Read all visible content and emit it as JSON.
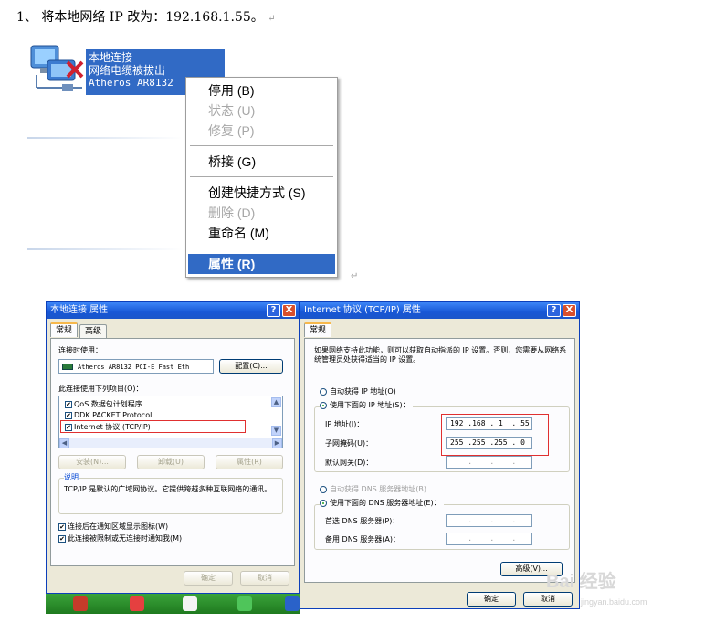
{
  "heading": {
    "text": "1、 将本地网络 IP 改为：192.168.1.55。",
    "para_mark": "↵"
  },
  "connection": {
    "line1": "本地连接",
    "line2": "网络电缆被拔出",
    "line3": "Atheros AR8132"
  },
  "context_menu": {
    "items": [
      {
        "label": "停用 (B)"
      },
      {
        "label": "状态 (U)"
      },
      {
        "label": "修复 (P)"
      },
      {
        "label": "桥接 (G)"
      },
      {
        "label": "创建快捷方式 (S)"
      },
      {
        "label": "删除 (D)"
      },
      {
        "label": "重命名 (M)"
      },
      {
        "label": "属性 (R)"
      }
    ]
  },
  "para_mark2": "↵",
  "dialog_left": {
    "title": "本地连接 属性",
    "help": "?",
    "close": "X",
    "tabs": [
      "常规",
      "高级"
    ],
    "connect_using_label": "连接时使用：",
    "adapter_name": "Atheros AR8132 PCI-E Fast Eth",
    "configure_button": "配置(C)...",
    "items_label": "此连接使用下列项目(O)：",
    "components": [
      {
        "label": "QoS 数据包计划程序",
        "checked": true
      },
      {
        "label": "DDK PACKET Protocol",
        "checked": true
      },
      {
        "label": "Internet 协议 (TCP/IP)",
        "checked": true
      }
    ],
    "install_button": "安装(N)...",
    "uninstall_button": "卸载(U)",
    "properties_button": "属性(R)",
    "description_title": "说明",
    "description_text": "TCP/IP 是默认的广域网协议。它提供跨越多种互联网络的通讯。",
    "show_icon_label": "连接后在通知区域显示图标(W)",
    "notify_label": "此连接被限制或无连接时通知我(M)",
    "ok_button": "确定",
    "cancel_button": "取消"
  },
  "dialog_right": {
    "title": "Internet 协议 (TCP/IP) 属性",
    "help": "?",
    "close": "X",
    "tab": "常规",
    "intro": "如果网络支持此功能，则可以获取自动指派的 IP 设置。否则，您需要从网络系统管理员处获得适当的 IP 设置。",
    "auto_ip_label": "自动获得 IP 地址(O)",
    "use_ip_label": "使用下面的 IP 地址(S)：",
    "ip_label": "IP 地址(I)：",
    "ip_value": "192 .168 . 1  . 55",
    "subnet_label": "子网掩码(U)：",
    "subnet_value": "255 .255 .255 . 0",
    "gateway_label": "默认网关(D)：",
    "gateway_value": "    .    .    .",
    "auto_dns_label": "自动获得 DNS 服务器地址(B)",
    "use_dns_label": "使用下面的 DNS 服务器地址(E)：",
    "dns1_label": "首选 DNS 服务器(P)：",
    "dns1_value": "    .    .    .",
    "dns2_label": "备用 DNS 服务器(A)：",
    "dns2_value": "    .    .    .",
    "advanced_button": "高级(V)...",
    "ok_button": "确定",
    "cancel_button": "取消"
  },
  "watermark": {
    "brand": "Bai 经验",
    "url": "jingyan.baidu.com"
  },
  "colors": {
    "selection": "#316ac5",
    "titlebar": "#1757d6",
    "dialog_bg": "#ece9d8",
    "highlight_box": "#e03030"
  }
}
